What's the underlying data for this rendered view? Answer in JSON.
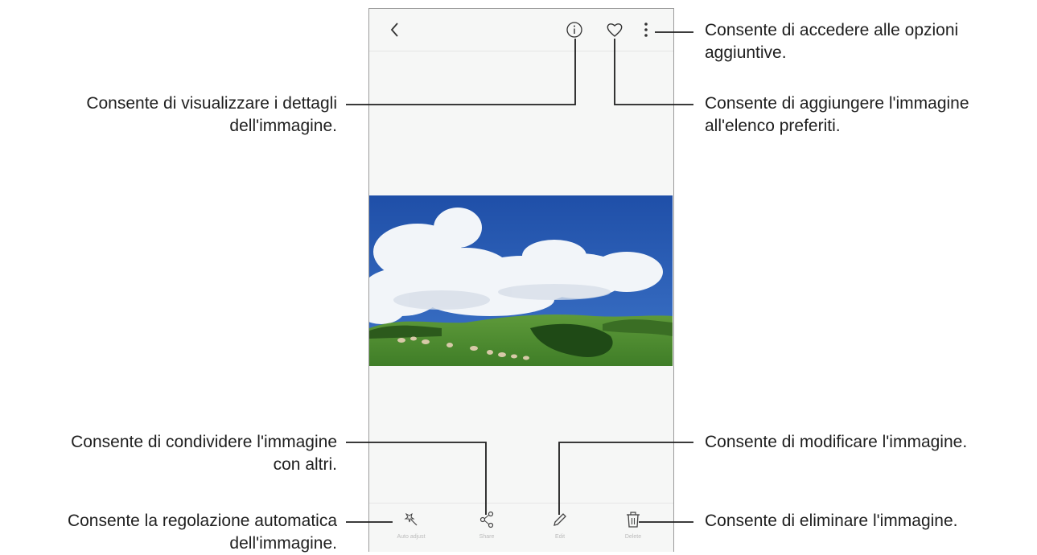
{
  "callouts": {
    "options": [
      "Consente di accedere alle opzioni",
      "aggiuntive."
    ],
    "details": [
      "Consente di visualizzare i dettagli",
      "dell'immagine."
    ],
    "favourite": [
      "Consente di aggiungere l'immagine",
      "all'elenco preferiti."
    ],
    "share": [
      "Consente di condividere l'immagine",
      "con altri."
    ],
    "edit": [
      "Consente di modificare l'immagine."
    ],
    "auto_adjust": [
      "Consente la regolazione automatica",
      "dell'immagine."
    ],
    "delete": [
      "Consente di eliminare l'immagine."
    ]
  },
  "bottom_bar": {
    "auto_adjust": "Auto adjust",
    "share": "Share",
    "edit": "Edit",
    "delete": "Delete"
  },
  "icons": {
    "back": "back-arrow-icon",
    "details": "info-icon",
    "favourite": "heart-icon",
    "more": "more-options-icon",
    "auto_adjust": "magic-wand-icon",
    "share": "share-icon",
    "edit": "pencil-icon",
    "delete": "trash-icon"
  },
  "colors": {
    "line": "#1f1f1f",
    "frame": "#9a9a9a",
    "screen": "#f6f7f6"
  }
}
